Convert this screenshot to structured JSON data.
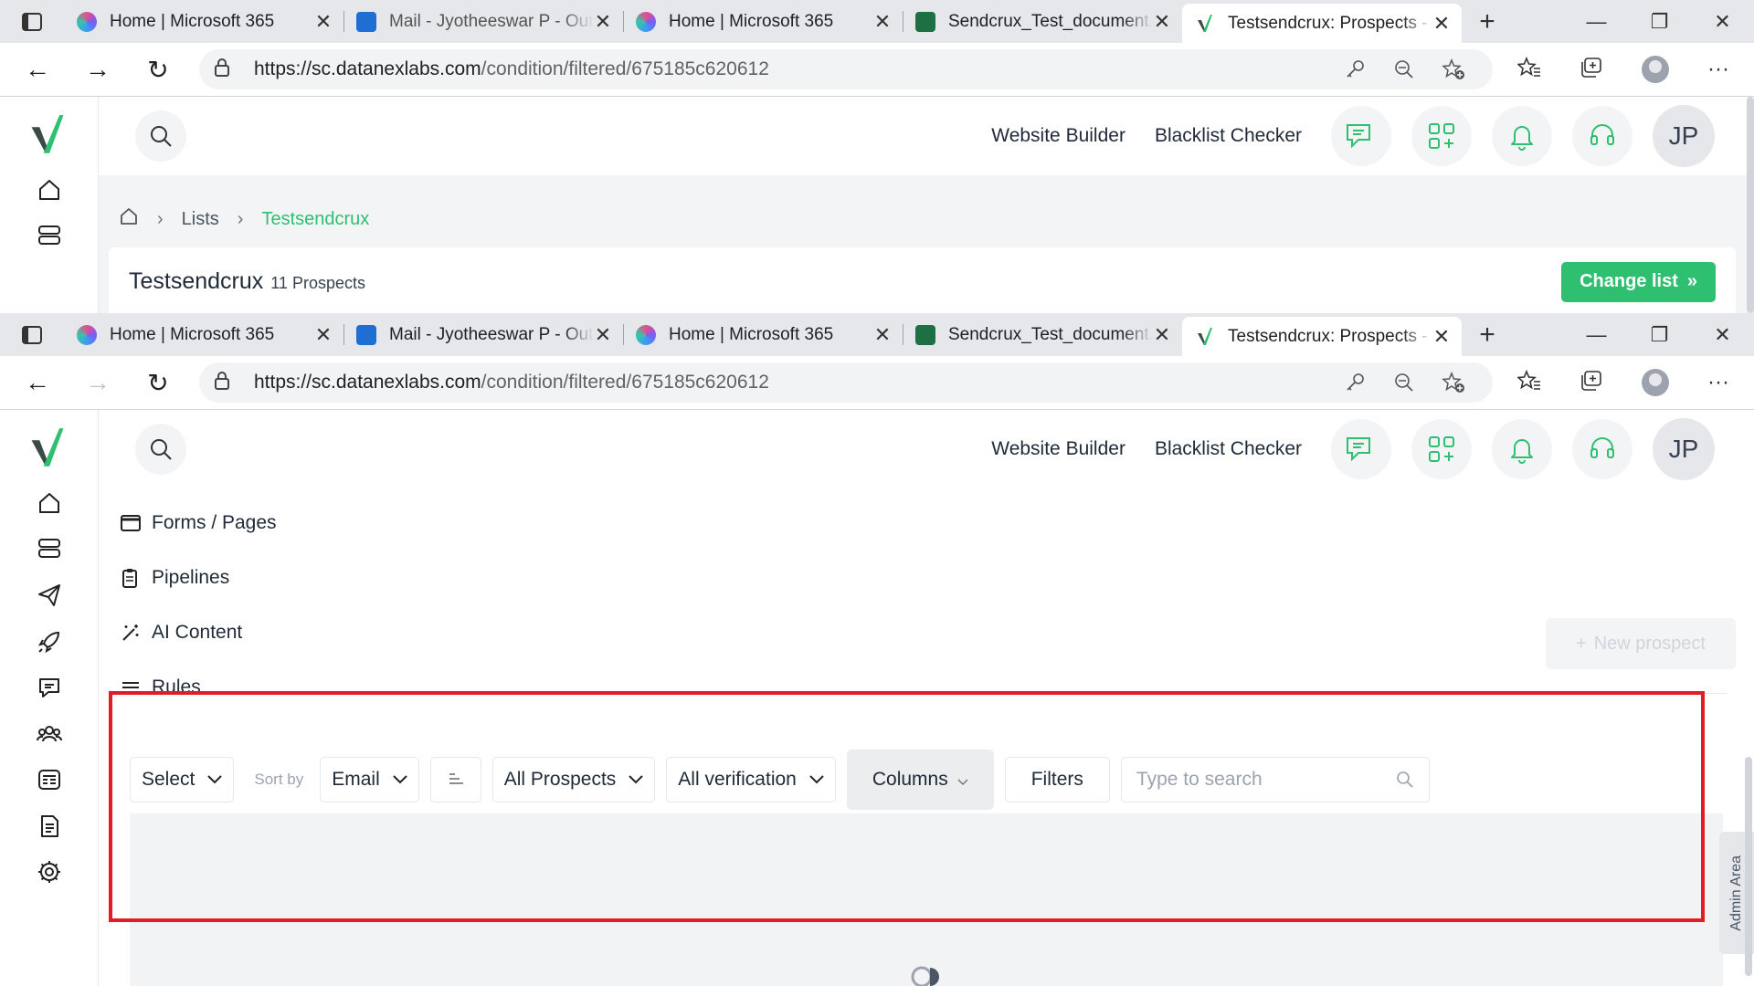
{
  "browser": {
    "tabs": [
      {
        "title": "Home | Microsoft 365",
        "icon": "microsoft-365-icon"
      },
      {
        "title": "Mail - Jyotheeswar P - Outlook",
        "icon": "outlook-icon"
      },
      {
        "title": "Home | Microsoft 365",
        "icon": "microsoft-365-icon"
      },
      {
        "title": "Sendcrux_Test_document.xlsx",
        "icon": "excel-icon"
      },
      {
        "title": "Testsendcrux: Prospects - Sendcrux",
        "icon": "sendcrux-icon",
        "active": true
      }
    ],
    "url_host": "https://sc.datanexlabs.com",
    "url_path": "/condition/filtered/675185c620612"
  },
  "app": {
    "brand_color": "#2fbf71",
    "header": {
      "website_builder": "Website Builder",
      "blacklist_checker": "Blacklist Checker",
      "avatar_initials": "JP"
    },
    "breadcrumb": {
      "lists": "Lists",
      "current": "Testsendcrux"
    },
    "list": {
      "title": "Testsendcrux",
      "count": "11 Prospects",
      "change_button": "Change list"
    },
    "menu": [
      {
        "label": "Forms / Pages"
      },
      {
        "label": "Pipelines"
      },
      {
        "label": "AI Content"
      },
      {
        "label": "Rules"
      }
    ],
    "new_prospect": "New prospect",
    "filters": {
      "select": "Select",
      "sort_by": "Sort by",
      "sort_field": "Email",
      "prospects_filter": "All Prospects",
      "verification_filter": "All verification",
      "columns": "Columns",
      "filters": "Filters",
      "search_placeholder": "Type to search"
    },
    "admin_area": "Admin Area",
    "highlight_color": "#e31b23"
  }
}
